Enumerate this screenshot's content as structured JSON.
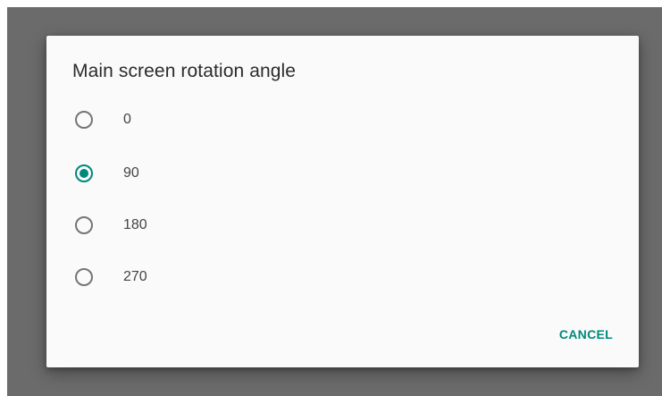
{
  "dialog": {
    "title": "Main screen rotation angle",
    "options": [
      {
        "label": "0",
        "selected": false
      },
      {
        "label": "90",
        "selected": true
      },
      {
        "label": "180",
        "selected": false
      },
      {
        "label": "270",
        "selected": false
      }
    ],
    "cancel_label": "CANCEL"
  },
  "colors": {
    "accent": "#00897b",
    "scrim": "#6b6b6b",
    "dialog_bg": "#fafafa",
    "radio_unchecked": "#757575"
  }
}
